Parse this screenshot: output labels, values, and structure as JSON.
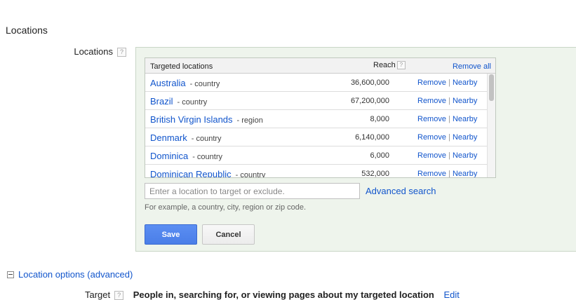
{
  "section": {
    "title": "Locations"
  },
  "locations_field": {
    "label": "Locations",
    "help": "?"
  },
  "table": {
    "header_location": "Targeted locations",
    "header_reach": "Reach",
    "header_help": "?",
    "remove_all": "Remove all",
    "rows": [
      {
        "name": "Australia",
        "type": "- country",
        "reach": "36,600,000",
        "remove": "Remove",
        "sep": "|",
        "nearby": "Nearby"
      },
      {
        "name": "Brazil",
        "type": "- country",
        "reach": "67,200,000",
        "remove": "Remove",
        "sep": "|",
        "nearby": "Nearby"
      },
      {
        "name": "British Virgin Islands",
        "type": "- region",
        "reach": "8,000",
        "remove": "Remove",
        "sep": "|",
        "nearby": "Nearby"
      },
      {
        "name": "Denmark",
        "type": "- country",
        "reach": "6,140,000",
        "remove": "Remove",
        "sep": "|",
        "nearby": "Nearby"
      },
      {
        "name": "Dominica",
        "type": "- country",
        "reach": "6,000",
        "remove": "Remove",
        "sep": "|",
        "nearby": "Nearby"
      },
      {
        "name": "Dominican Republic",
        "type": "- country",
        "reach": "532,000",
        "remove": "Remove",
        "sep": "|",
        "nearby": "Nearby"
      }
    ]
  },
  "search": {
    "placeholder": "Enter a location to target or exclude.",
    "value": "",
    "advanced": "Advanced search",
    "hint": "For example, a country, city, region or zip code."
  },
  "buttons": {
    "save": "Save",
    "cancel": "Cancel"
  },
  "options": {
    "toggle": "Location options (advanced)"
  },
  "target": {
    "label": "Target",
    "help": "?",
    "value": "People in, searching for, or viewing pages about my targeted location",
    "edit": "Edit"
  },
  "colors": {
    "link": "#1155cc",
    "panel_bg": "#eef4ec",
    "save_bg": "#4d84ee"
  }
}
